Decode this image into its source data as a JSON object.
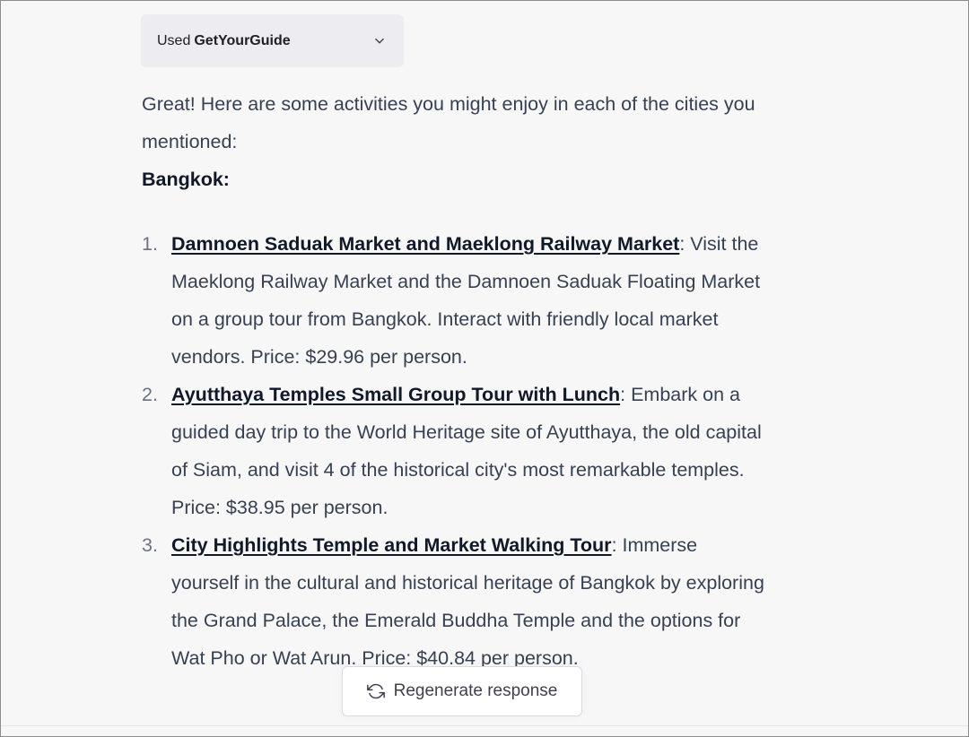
{
  "plugin": {
    "used_label": "Used",
    "name": "GetYourGuide"
  },
  "intro": "Great! Here are some activities you might enjoy in each of the cities you mentioned:",
  "section": {
    "title": "Bangkok:"
  },
  "items": [
    {
      "number": "1.",
      "title": "Damnoen Saduak Market and Maeklong Railway Market",
      "desc": ": Visit the Maeklong Railway Market and the Damnoen Saduak Floating Market on a group tour from Bangkok. Interact with friendly local market vendors. Price: $29.96 per person."
    },
    {
      "number": "2.",
      "title": "Ayutthaya Temples Small Group Tour with Lunch",
      "desc": ": Embark on a guided day trip to the World Heritage site of Ayutthaya, the old capital of Siam, and visit 4 of the historical city's most remarkable temples. Price: $38.95 per person."
    },
    {
      "number": "3.",
      "title": "City Highlights Temple and Market Walking Tour",
      "desc": ": Immerse yourself in the cultural and historical heritage of Bangkok by exploring the Grand Palace, the Emerald Buddha Temple and the options for Wat Pho or Wat Arun. Price: $40.84 per person."
    }
  ],
  "regenerate": {
    "label": "Regenerate response",
    "icon": "refresh-icon"
  },
  "icons": {
    "chevron": "chevron-down-icon"
  }
}
